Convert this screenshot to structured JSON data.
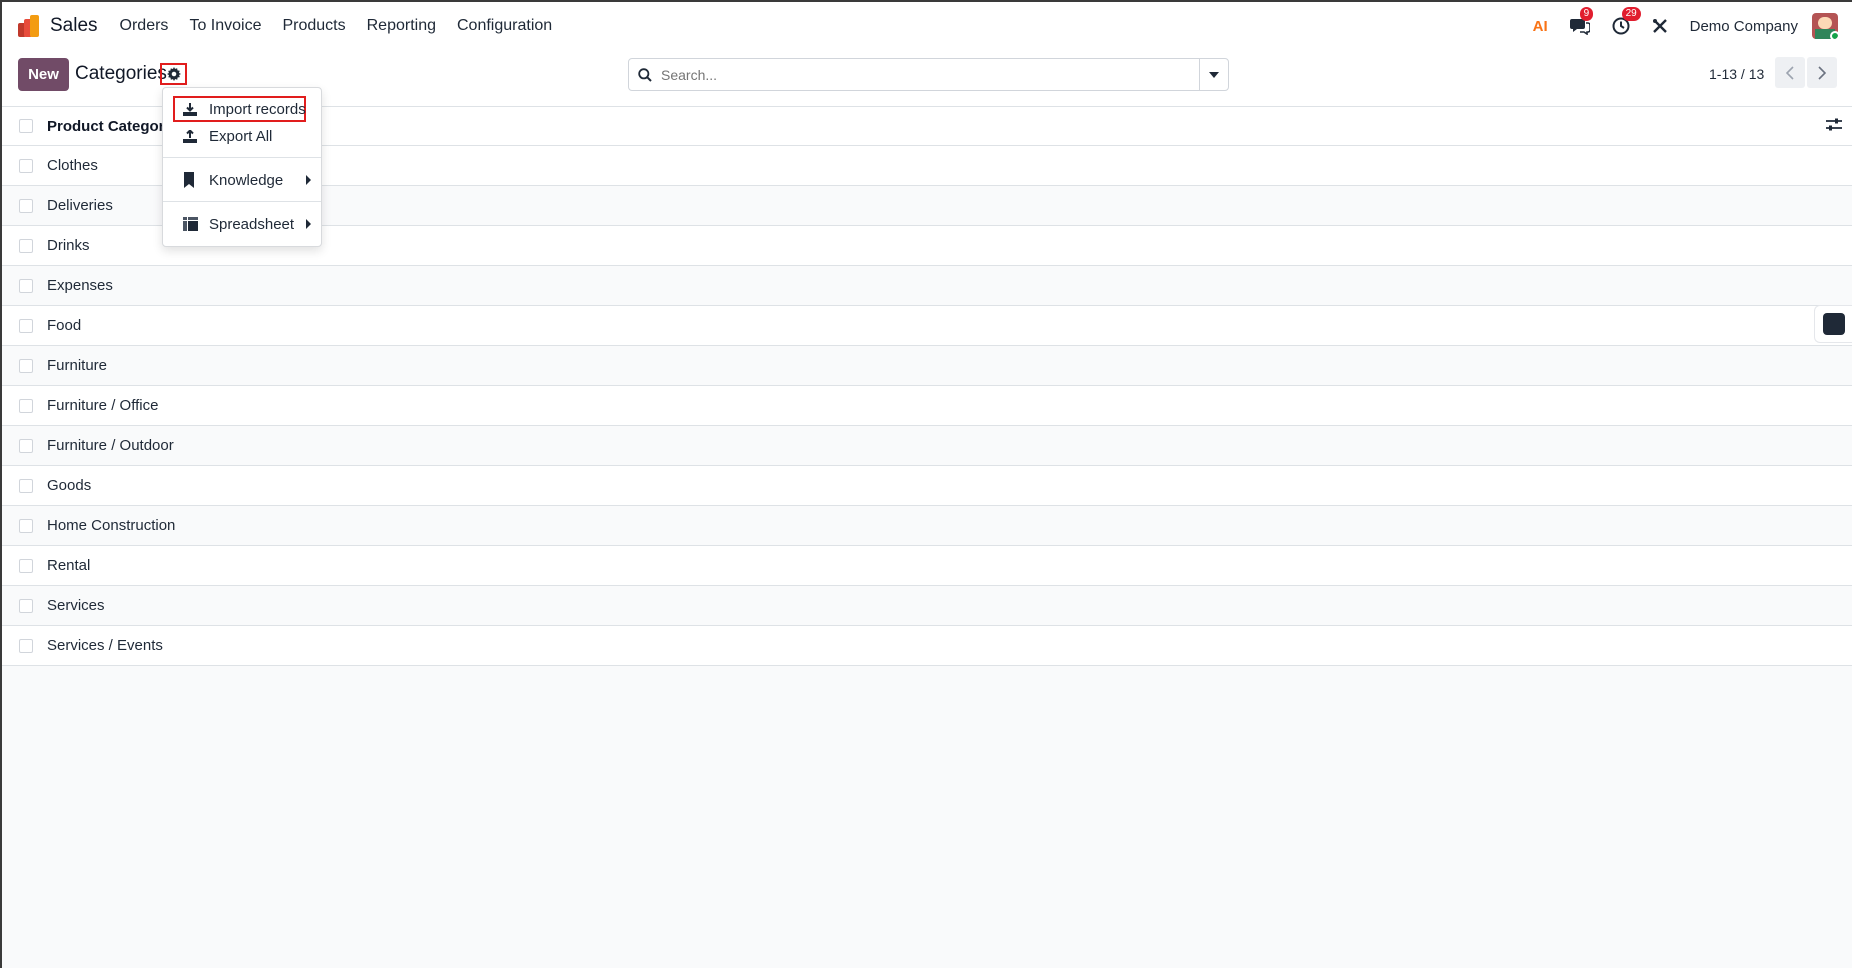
{
  "navbar": {
    "app_name": "Sales",
    "menu": [
      "Orders",
      "To Invoice",
      "Products",
      "Reporting",
      "Configuration"
    ],
    "messages_badge": "9",
    "activities_badge": "29",
    "company": "Demo Company",
    "ai_label": "AI"
  },
  "control_panel": {
    "new_label": "New",
    "breadcrumb": "Categories",
    "search_placeholder": "Search...",
    "pager": "1-13 / 13"
  },
  "list": {
    "column": "Product Category",
    "rows": [
      "Clothes",
      "Deliveries",
      "Drinks",
      "Expenses",
      "Food",
      "Furniture",
      "Furniture / Office",
      "Furniture / Outdoor",
      "Goods",
      "Home Construction",
      "Rental",
      "Services",
      "Services / Events"
    ]
  },
  "dropdown": {
    "import": "Import records",
    "export": "Export All",
    "knowledge": "Knowledge",
    "spreadsheet": "Spreadsheet"
  },
  "colors": {
    "primary": "#714b67",
    "highlight": "#e11d1d",
    "badge": "#e11d2e"
  }
}
